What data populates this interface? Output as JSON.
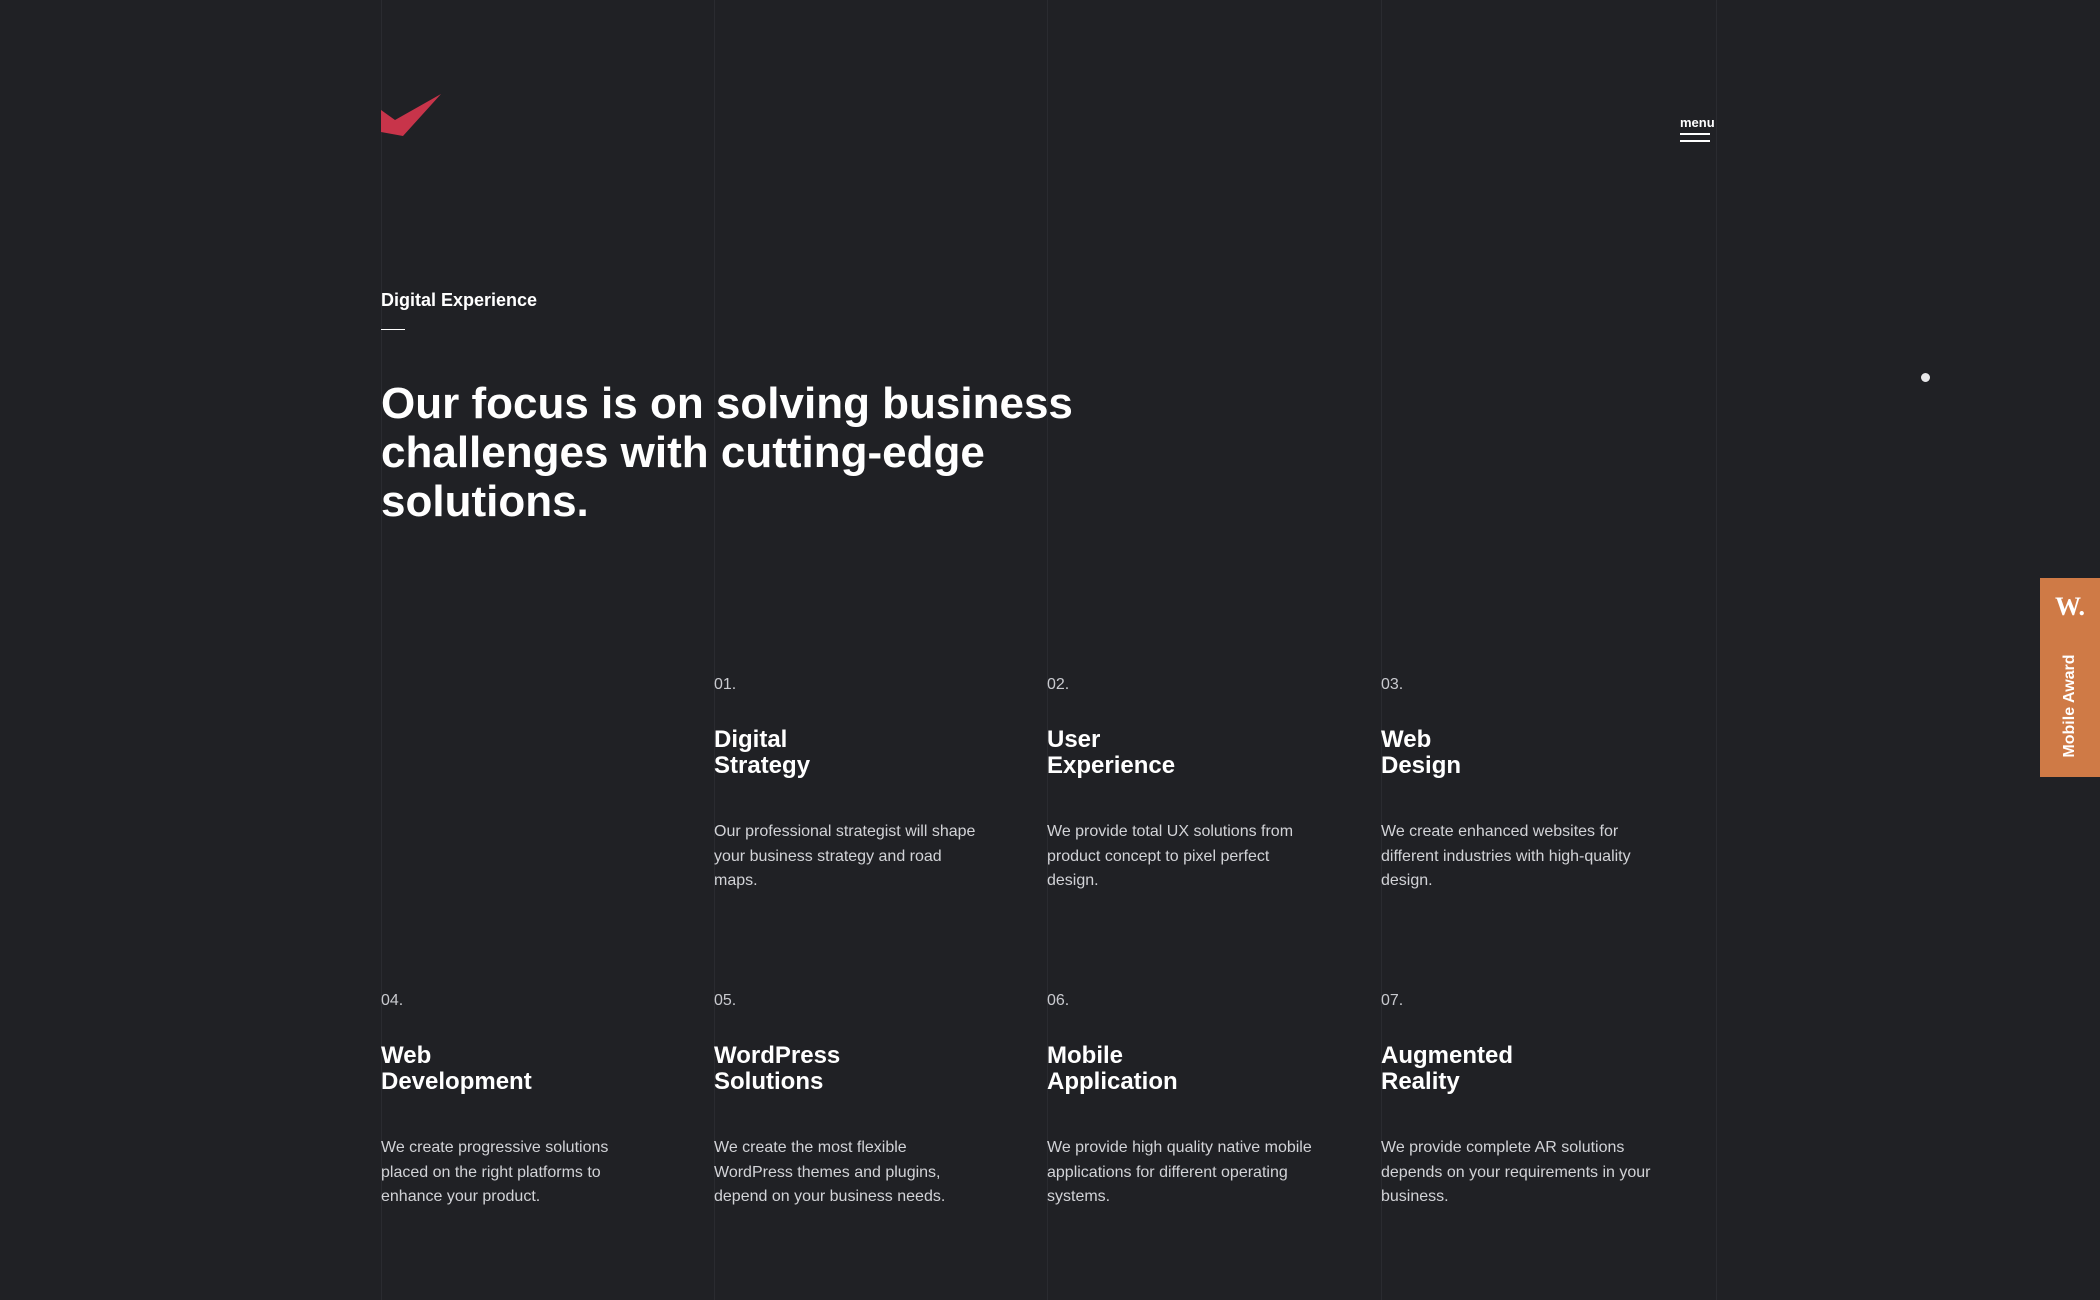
{
  "header": {
    "logo_name": "checkmark-logo",
    "brand_color": "#c8344a",
    "menu_label": "menu"
  },
  "hero": {
    "eyebrow": "Digital Experience",
    "headline": "Our focus is on solving business challenges with cutting-edge solutions."
  },
  "services": [
    {
      "number": "01.",
      "title": "Digital\nStrategy",
      "description": "Our professional strategist will shape your business strategy and road maps."
    },
    {
      "number": "02.",
      "title": "User\nExperience",
      "description": "We provide total UX solutions from product concept to pixel perfect design."
    },
    {
      "number": "03.",
      "title": "Web\nDesign",
      "description": "We create enhanced websites for different industries with high-quality design."
    },
    {
      "number": "04.",
      "title": "Web\nDevelopment",
      "description": "We create progressive solutions placed on the right platforms to enhance your product."
    },
    {
      "number": "05.",
      "title": "WordPress\nSolutions",
      "description": "We create the most flexible WordPress themes and plugins, depend on your business needs."
    },
    {
      "number": "06.",
      "title": "Mobile\nApplication",
      "description": "We provide high quality native mobile applications for different operating systems."
    },
    {
      "number": "07.",
      "title": "Augmented\nReality",
      "description": "We provide complete AR solutions depends on your requirements in your business."
    }
  ],
  "award_badge": {
    "logo": "W.",
    "label": "Mobile Award",
    "color": "#cf7a46"
  },
  "colors": {
    "background": "#202125",
    "text": "#ffffff",
    "muted_text": "#d2d3d7"
  }
}
